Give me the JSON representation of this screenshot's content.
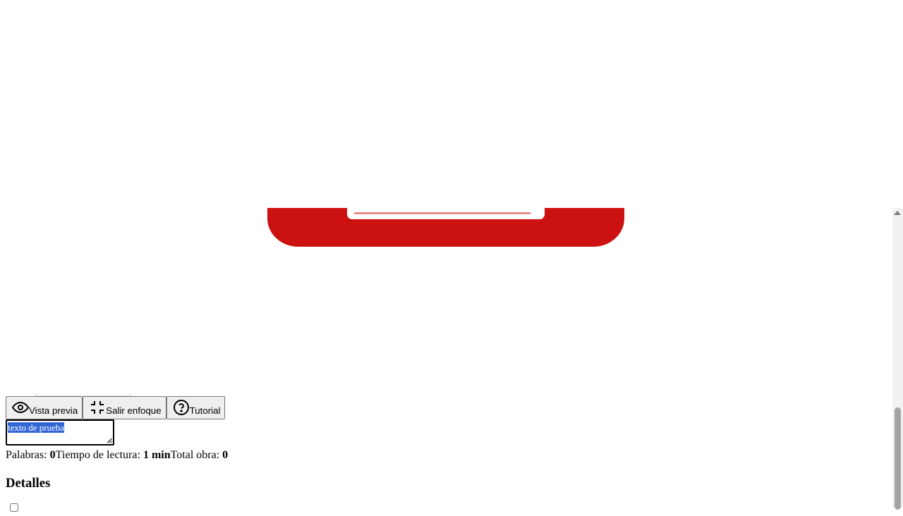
{
  "toolbar": {
    "preview_label": "Vista previa",
    "exit_focus_label": "Salir enfoque",
    "tutorial_label": "Tutorial"
  },
  "icons": {
    "preview": "eye-icon",
    "exit_focus": "collapse-icon",
    "tutorial": "help-circle-icon"
  },
  "editor": {
    "value": "texto de prueba",
    "selected": true
  },
  "stats": {
    "words_label": "Palabras: ",
    "words_value": "0",
    "reading_time_label": "Tiempo de lectura: ",
    "reading_time_value": "1 min",
    "total_label": "Total obra: ",
    "total_value": "0"
  },
  "details": {
    "heading": "Detalles"
  },
  "colors": {
    "banner_red": "#cc1111",
    "selection_blue": "#3367d6"
  }
}
